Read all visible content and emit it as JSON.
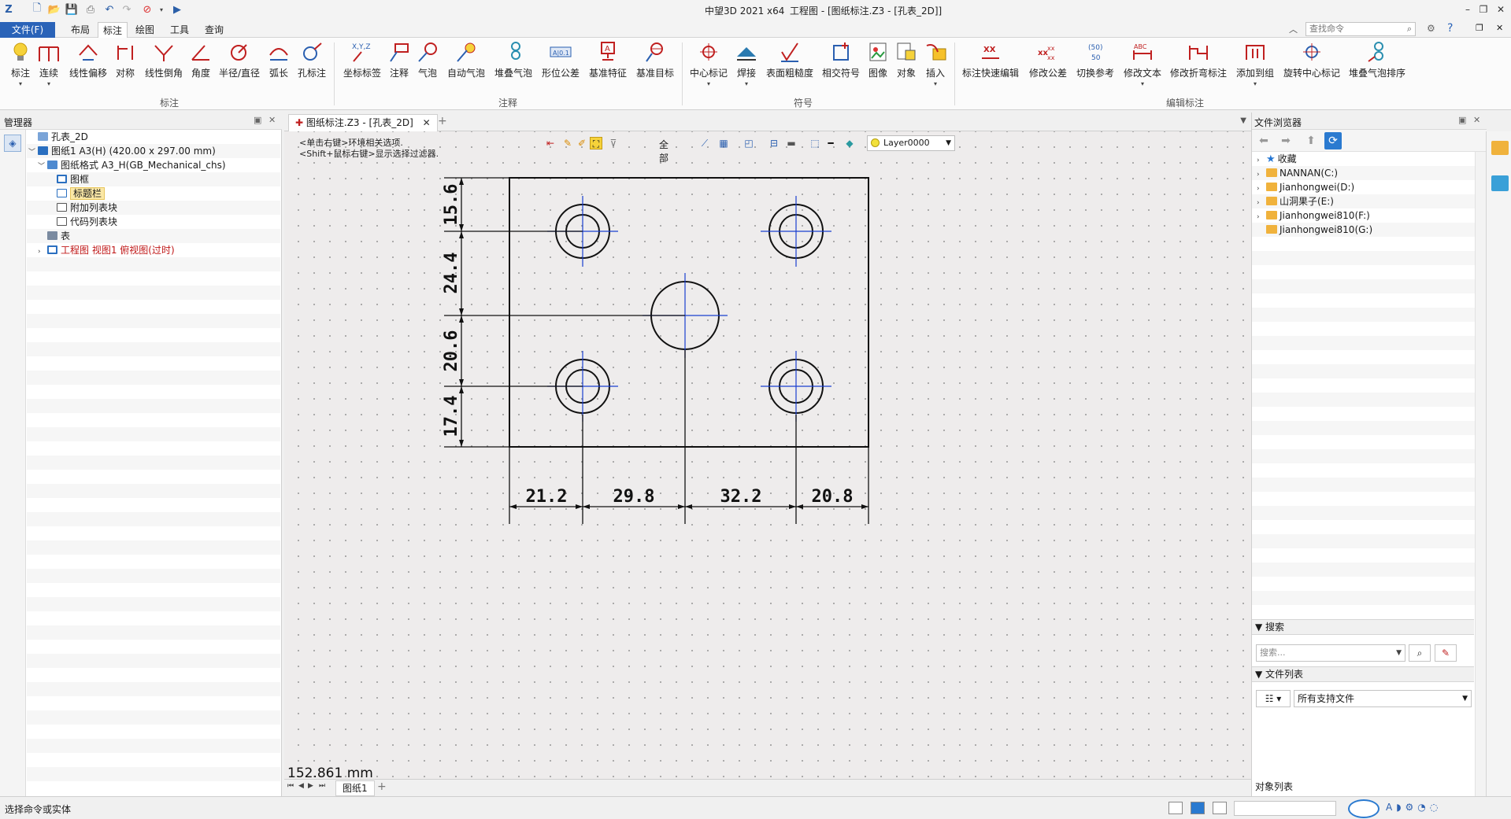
{
  "titlebar": {
    "app_title": "中望3D 2021 x64",
    "doc_title": "工程图 - [图纸标注.Z3 - [孔表_2D]]",
    "search_placeholder": "查找命令"
  },
  "menu": {
    "file": "文件(F)",
    "items": [
      "布局",
      "标注",
      "绘图",
      "工具",
      "查询"
    ],
    "active": "标注"
  },
  "ribbon": {
    "groups": [
      {
        "name": "标注",
        "buttons": [
          "标注",
          "连续",
          "线性偏移",
          "对称",
          "线性倒角",
          "角度",
          "半径/直径",
          "弧长",
          "孔标注"
        ]
      },
      {
        "name": "注释",
        "buttons": [
          "坐标标签",
          "注释",
          "气泡",
          "自动气泡",
          "堆叠气泡",
          "形位公差",
          "基准特征",
          "基准目标"
        ]
      },
      {
        "name": "符号",
        "buttons": [
          "中心标记",
          "焊接",
          "表面粗糙度",
          "相交符号",
          "图像",
          "对象",
          "插入"
        ]
      },
      {
        "name": "编辑标注",
        "buttons": [
          "标注快速编辑",
          "修改公差",
          "切换参考",
          "修改文本",
          "修改折弯标注",
          "添加到组",
          "旋转中心标记",
          "堆叠气泡排序"
        ]
      }
    ]
  },
  "left_panel": {
    "title": "管理器",
    "tree": [
      {
        "label": "孔表_2D",
        "level": 0,
        "toggle": ""
      },
      {
        "label": "图纸1 A3(H) (420.00 x 297.00 mm)",
        "level": 0,
        "toggle": "﹀"
      },
      {
        "label": "图纸格式 A3_H(GB_Mechanical_chs)",
        "level": 1,
        "toggle": "﹀"
      },
      {
        "label": "图框",
        "level": 2,
        "toggle": ""
      },
      {
        "label": "标题栏",
        "level": 2,
        "toggle": "",
        "selected": true
      },
      {
        "label": "附加列表块",
        "level": 2,
        "toggle": ""
      },
      {
        "label": "代码列表块",
        "level": 2,
        "toggle": ""
      },
      {
        "label": "表",
        "level": 1,
        "toggle": ""
      },
      {
        "label": "工程图 视图1 俯视图(过时)",
        "level": 1,
        "toggle": "›",
        "red": true
      }
    ]
  },
  "canvas": {
    "tab_label": "图纸标注.Z3 - [孔表_2D]",
    "hint1": "<单击右键>环境相关选项.",
    "hint2": "<Shift+鼠标右键>显示选择过滤器.",
    "filter_all": "全部",
    "layer": "Layer0000",
    "measure": "152.861 mm",
    "sheet_tab": "图纸1",
    "dims_vertical": [
      "15.6",
      "24.4",
      "20.6",
      "17.4"
    ],
    "dims_horizontal": [
      "21.2",
      "29.8",
      "32.2",
      "20.8"
    ]
  },
  "right_panel": {
    "title": "文件浏览器",
    "favorites": "收藏",
    "drives": [
      "NANNAN(C:)",
      "Jianhongwei(D:)",
      "山洞果子(E:)",
      "Jianhongwei810(F:)",
      "Jianhongwei810(G:)"
    ],
    "search_section": "搜索",
    "search_placeholder": "搜索...",
    "filelist_section": "文件列表",
    "filter_value": "所有支持文件",
    "object_list": "对象列表"
  },
  "status": {
    "text": "选择命令或实体"
  },
  "colors": {
    "file_menu": "#2a63b8",
    "selected_node": "#fbe8a6",
    "drawing_line": "#111111",
    "centerline": "#1a3fd0",
    "folder": "#f0b23c"
  }
}
